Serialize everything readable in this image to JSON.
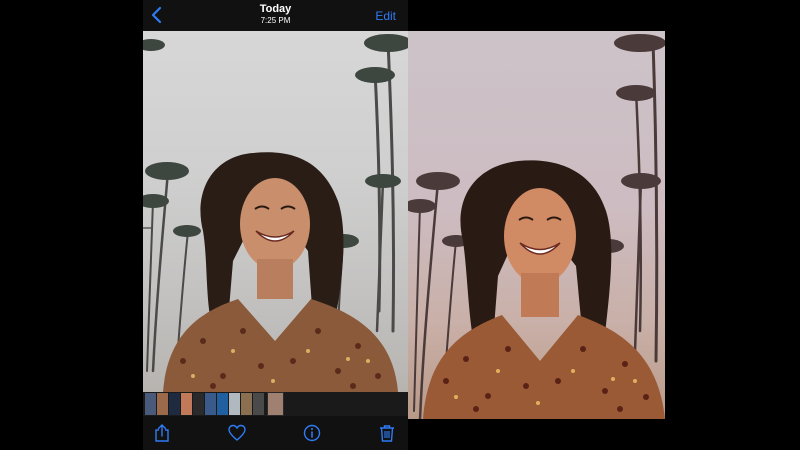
{
  "navbar": {
    "title": "Today",
    "subtitle": "7:25 PM",
    "edit_label": "Edit"
  },
  "colors": {
    "accent": "#2f7bf6",
    "bar_background": "#111111",
    "thumb_strip_background": "#1a1a1a",
    "before_photo_sky": "#d7d7d7",
    "after_photo_sky": "#ccc3c8"
  },
  "photos": [
    {
      "name": "before-photo",
      "edit": "original"
    },
    {
      "name": "after-photo",
      "edit": "warm pink filter"
    }
  ],
  "thumbnails": [
    {
      "color": "#4a5a7a"
    },
    {
      "color": "#9a6a4a"
    },
    {
      "color": "#1e2a40"
    },
    {
      "color": "#c07a5a"
    },
    {
      "color": "#2a2a2a"
    },
    {
      "color": "#3a5a8a"
    },
    {
      "color": "#2060a0"
    },
    {
      "color": "#b0b8c0"
    },
    {
      "color": "#8a7050"
    },
    {
      "color": "#4a4a4a"
    },
    {
      "color": "#a08070",
      "current": true
    }
  ],
  "toolbar": {
    "icons": [
      "share-icon",
      "heart-icon",
      "info-icon",
      "trash-icon"
    ]
  }
}
